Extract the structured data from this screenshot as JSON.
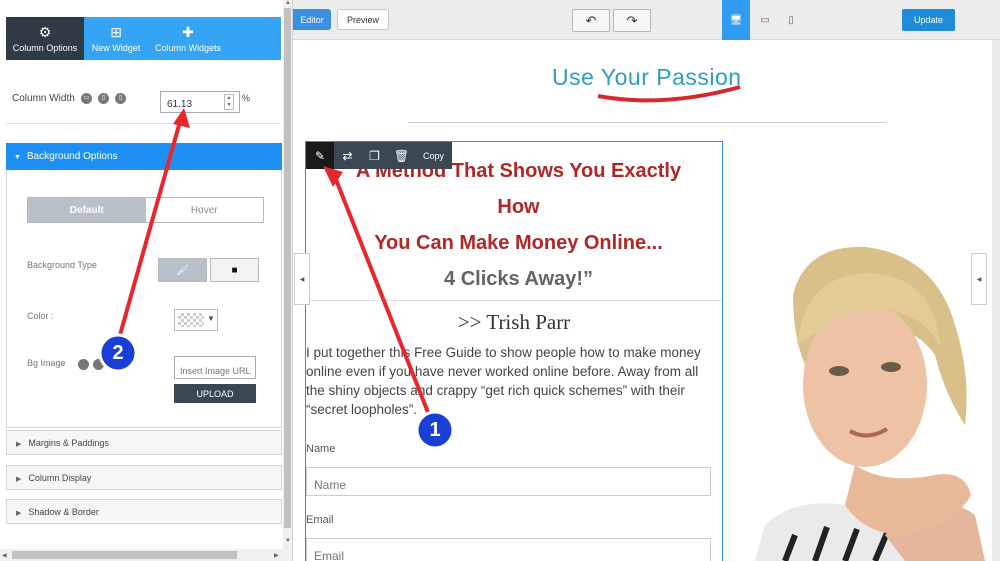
{
  "panel": {
    "tabs": [
      {
        "label": "Column Options",
        "icon": "gears-icon",
        "active": true
      },
      {
        "label": "New Widget",
        "icon": "plus-square-icon",
        "active": false
      },
      {
        "label": "Column Widgets",
        "icon": "puzzle-icon",
        "active": false
      }
    ],
    "column_width": {
      "label": "Column Width",
      "value": "61.13",
      "unit": "%"
    },
    "background_section": {
      "title": "Background Options",
      "state_tabs": {
        "default": "Default",
        "hover": "Hover"
      },
      "background_type_label": "Background Type",
      "color_label": "Color :",
      "bg_image_label": "Bg Image",
      "image_url_placeholder": "Insert Image URL",
      "upload_label": "UPLOAD"
    },
    "collapsed_sections": [
      "Margins & Paddings",
      "Column Display",
      "Shadow & Border"
    ]
  },
  "topbar": {
    "editor_label": "Editor",
    "preview_label": "Preview",
    "update_label": "Update",
    "active_device": "desktop"
  },
  "canvas": {
    "logo_text": "Use Your Passion",
    "toolbar": {
      "copy_label": "Copy"
    },
    "headline": {
      "line1": "A Method That Shows You Exactly",
      "line2": "How",
      "line3": "You Can Make Money Online...",
      "line4": "4 Clicks Away!”"
    },
    "author": ">> Trish Parr",
    "intro": "I put together this Free Guide to show people how to make money online even if you have never worked online before. Away from all the shiny objects and crappy “get rich quick schemes” with their “secret loopholes”.",
    "form": {
      "name_label": "Name",
      "name_placeholder": "Name",
      "email_label": "Email",
      "email_placeholder": "Email"
    }
  },
  "annotations": [
    {
      "number": "1"
    },
    {
      "number": "2"
    }
  ],
  "colors": {
    "panel_tab_blue": "#35a4f4",
    "section_blue": "#1e90f4",
    "headline_red": "#b22626",
    "arrow_red": "#e8262b",
    "marker_blue": "#1a3fd6"
  }
}
